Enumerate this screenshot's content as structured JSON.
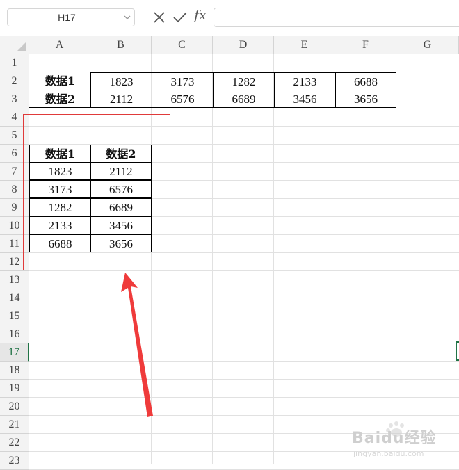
{
  "formula_bar": {
    "name_box": "H17",
    "fx_label": "fx",
    "formula_value": ""
  },
  "columns": [
    "A",
    "B",
    "C",
    "D",
    "E",
    "F",
    "G"
  ],
  "rows": [
    "1",
    "2",
    "3",
    "4",
    "5",
    "6",
    "7",
    "8",
    "9",
    "10",
    "11",
    "12",
    "13",
    "14",
    "15",
    "16",
    "17",
    "18",
    "19",
    "20",
    "21",
    "22",
    "23"
  ],
  "active_row": "17",
  "horizontal_table": {
    "row2": {
      "label": "数据1",
      "values": [
        "1823",
        "3173",
        "1282",
        "2133",
        "6688"
      ]
    },
    "row3": {
      "label": "数据2",
      "values": [
        "2112",
        "6576",
        "6689",
        "3456",
        "3656"
      ]
    }
  },
  "vertical_table": {
    "headers": [
      "数据1",
      "数据2"
    ],
    "rows": [
      [
        "1823",
        "2112"
      ],
      [
        "3173",
        "6576"
      ],
      [
        "1282",
        "6689"
      ],
      [
        "2133",
        "3456"
      ],
      [
        "6688",
        "3656"
      ]
    ]
  },
  "annotation": {
    "highlight_color": "#e03a3a",
    "arrow_color": "#ef3b3b"
  },
  "watermark": {
    "text": "Baidu经验",
    "sub": "jingyan.baidu.com"
  }
}
